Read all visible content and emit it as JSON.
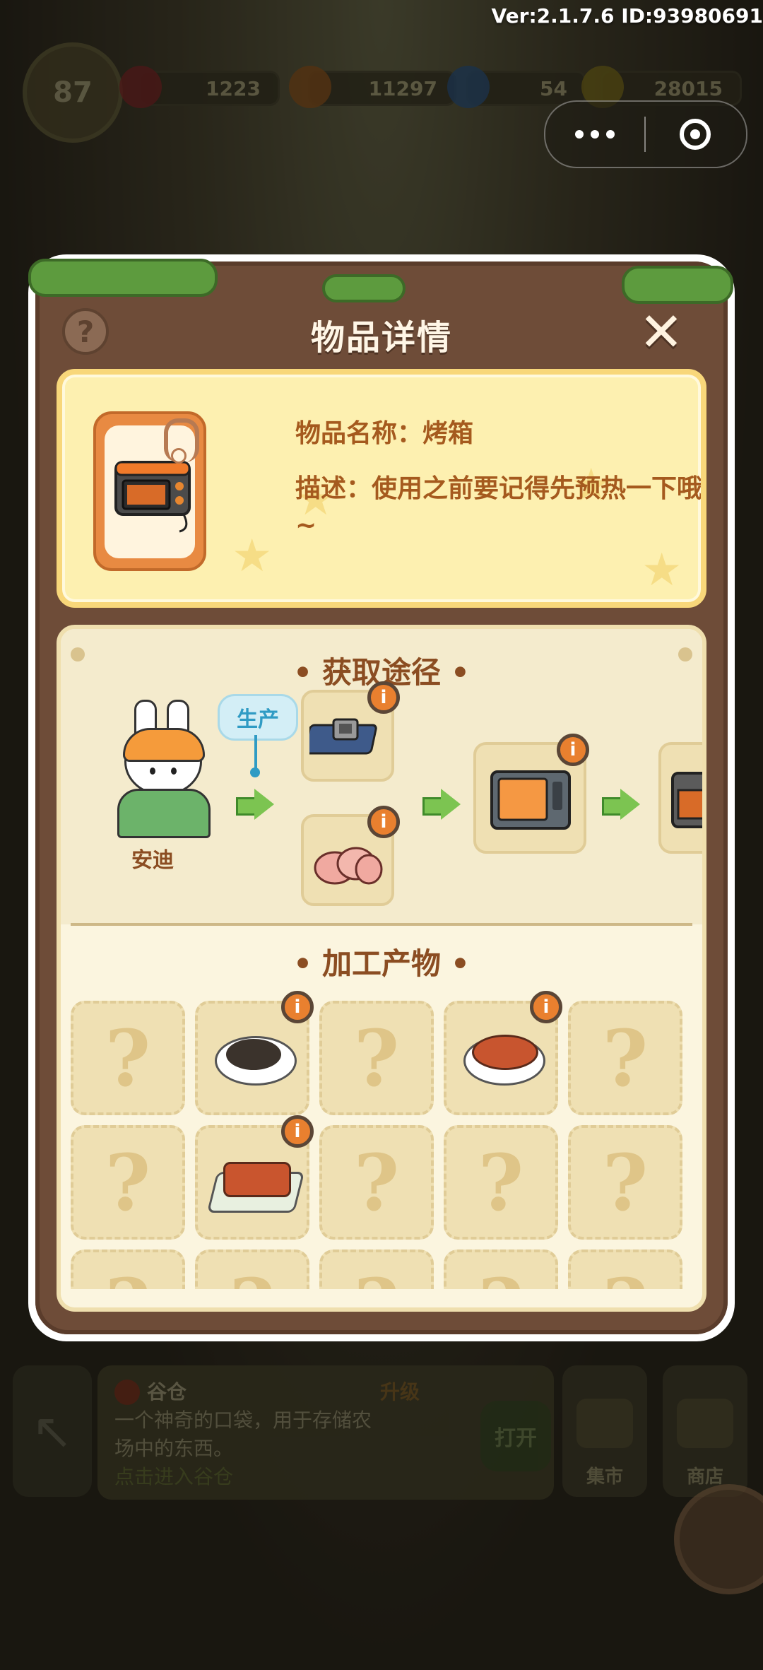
{
  "version_text": "Ver:2.1.7.6 ID:93980691",
  "resources": {
    "level": "87",
    "gems": "1223",
    "carrots": "11297",
    "energy": "54",
    "coins": "28015"
  },
  "modal": {
    "title": "物品详情",
    "item_name_line": "物品名称：烤箱",
    "item_desc_line": "描述：使用之前要记得先预热一下哦~",
    "source_title": "获取途径",
    "character_name": "安迪",
    "produce_label": "生产",
    "products_title": "加工产物",
    "info_glyph": "i",
    "unknown_glyph": "?"
  },
  "bottom": {
    "card_title": "谷仓",
    "card_upgrade": "升级",
    "card_desc1": "一个神奇的口袋，用于存储农",
    "card_desc2": "场中的东西。",
    "card_link": "点击进入谷仓",
    "open_label": "打开",
    "market_label": "集市",
    "shop_label": "商店"
  },
  "colors": {
    "modal_brown": "#6e4c38",
    "card_yellow": "#fdf0b0",
    "title_text": "#fff6e6",
    "label_brown": "#8b4d22",
    "accent_orange": "#e9802f",
    "arrow_green": "#7cc451",
    "produce_blue": "#2f9bc4"
  }
}
